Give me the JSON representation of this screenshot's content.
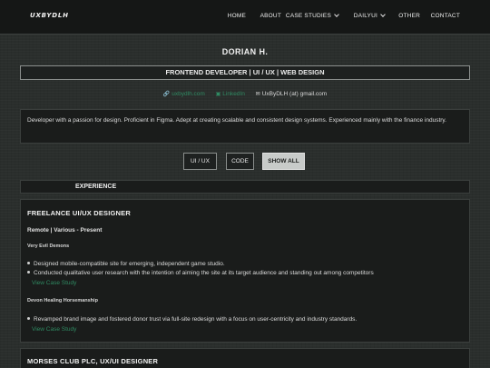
{
  "app": {
    "logo": "UXBYDLH"
  },
  "nav": {
    "items": [
      {
        "label": "HOME"
      },
      {
        "label": "ABOUT"
      },
      {
        "label": "CASE STUDIES"
      },
      {
        "label": "DAILYUI"
      },
      {
        "label": "OTHER"
      },
      {
        "label": "CONTACT"
      }
    ]
  },
  "profile": {
    "name": "DORIAN H.",
    "title": "FRONTEND DEVELOPER | UI / UX | WEB DESIGN",
    "contacts": {
      "website": "uxbydlh.com",
      "linkedin": "LinkedIn",
      "email": "UxByDLH (at) gmail.com"
    },
    "bio": "Developer with a passion for design. Proficient in Figma. Adept at creating scalable and consistent design systems. Experienced mainly with the finance industry."
  },
  "filters": {
    "ui_ux": "UI / UX",
    "code": "CODE",
    "show_all": "SHOW ALL",
    "active": "SHOW ALL"
  },
  "experience": {
    "header": "EXPERIENCE",
    "jobs": [
      {
        "title": "FREELANCE UI/UX DESIGNER",
        "meta": "Remote | Various - Present",
        "clients": [
          {
            "name": "Very Evil Demons",
            "bullets": [
              "Designed mobile-compatible site for emerging, independent game studio.",
              "Conducted qualitative user research with the intention of aiming the site at its target audience and standing out among competitors"
            ],
            "link": "View Case Study"
          },
          {
            "name": "Devon Healing Horsemanship",
            "bullets": [
              "Revamped brand image and fostered donor trust via full-site redesign with a focus on user-centricity and industry standards."
            ],
            "link": "View Case Study"
          }
        ]
      },
      {
        "title": "MORSES CLUB PLC, UX/UI DESIGNER"
      }
    ]
  },
  "colors": {
    "accent": "#2f8a62",
    "background": "#2a2e2c",
    "panel": "#1a1c1b",
    "navbar": "#151716"
  }
}
